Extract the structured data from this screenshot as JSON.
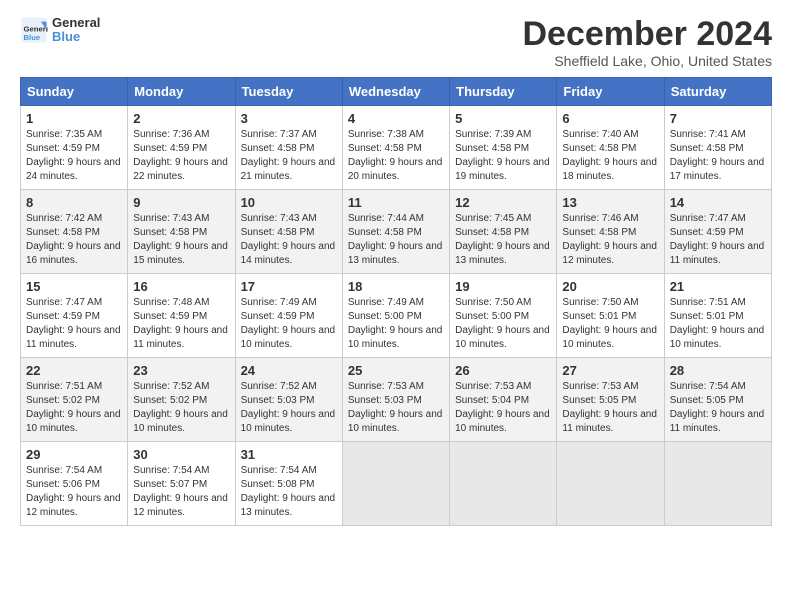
{
  "logo": {
    "line1": "General",
    "line2": "Blue"
  },
  "title": "December 2024",
  "location": "Sheffield Lake, Ohio, United States",
  "days": [
    "Sunday",
    "Monday",
    "Tuesday",
    "Wednesday",
    "Thursday",
    "Friday",
    "Saturday"
  ],
  "weeks": [
    [
      {
        "num": "1",
        "sunrise": "7:35 AM",
        "sunset": "4:59 PM",
        "daylight": "9 hours and 24 minutes."
      },
      {
        "num": "2",
        "sunrise": "7:36 AM",
        "sunset": "4:59 PM",
        "daylight": "9 hours and 22 minutes."
      },
      {
        "num": "3",
        "sunrise": "7:37 AM",
        "sunset": "4:58 PM",
        "daylight": "9 hours and 21 minutes."
      },
      {
        "num": "4",
        "sunrise": "7:38 AM",
        "sunset": "4:58 PM",
        "daylight": "9 hours and 20 minutes."
      },
      {
        "num": "5",
        "sunrise": "7:39 AM",
        "sunset": "4:58 PM",
        "daylight": "9 hours and 19 minutes."
      },
      {
        "num": "6",
        "sunrise": "7:40 AM",
        "sunset": "4:58 PM",
        "daylight": "9 hours and 18 minutes."
      },
      {
        "num": "7",
        "sunrise": "7:41 AM",
        "sunset": "4:58 PM",
        "daylight": "9 hours and 17 minutes."
      }
    ],
    [
      {
        "num": "8",
        "sunrise": "7:42 AM",
        "sunset": "4:58 PM",
        "daylight": "9 hours and 16 minutes."
      },
      {
        "num": "9",
        "sunrise": "7:43 AM",
        "sunset": "4:58 PM",
        "daylight": "9 hours and 15 minutes."
      },
      {
        "num": "10",
        "sunrise": "7:43 AM",
        "sunset": "4:58 PM",
        "daylight": "9 hours and 14 minutes."
      },
      {
        "num": "11",
        "sunrise": "7:44 AM",
        "sunset": "4:58 PM",
        "daylight": "9 hours and 13 minutes."
      },
      {
        "num": "12",
        "sunrise": "7:45 AM",
        "sunset": "4:58 PM",
        "daylight": "9 hours and 13 minutes."
      },
      {
        "num": "13",
        "sunrise": "7:46 AM",
        "sunset": "4:58 PM",
        "daylight": "9 hours and 12 minutes."
      },
      {
        "num": "14",
        "sunrise": "7:47 AM",
        "sunset": "4:59 PM",
        "daylight": "9 hours and 11 minutes."
      }
    ],
    [
      {
        "num": "15",
        "sunrise": "7:47 AM",
        "sunset": "4:59 PM",
        "daylight": "9 hours and 11 minutes."
      },
      {
        "num": "16",
        "sunrise": "7:48 AM",
        "sunset": "4:59 PM",
        "daylight": "9 hours and 11 minutes."
      },
      {
        "num": "17",
        "sunrise": "7:49 AM",
        "sunset": "4:59 PM",
        "daylight": "9 hours and 10 minutes."
      },
      {
        "num": "18",
        "sunrise": "7:49 AM",
        "sunset": "5:00 PM",
        "daylight": "9 hours and 10 minutes."
      },
      {
        "num": "19",
        "sunrise": "7:50 AM",
        "sunset": "5:00 PM",
        "daylight": "9 hours and 10 minutes."
      },
      {
        "num": "20",
        "sunrise": "7:50 AM",
        "sunset": "5:01 PM",
        "daylight": "9 hours and 10 minutes."
      },
      {
        "num": "21",
        "sunrise": "7:51 AM",
        "sunset": "5:01 PM",
        "daylight": "9 hours and 10 minutes."
      }
    ],
    [
      {
        "num": "22",
        "sunrise": "7:51 AM",
        "sunset": "5:02 PM",
        "daylight": "9 hours and 10 minutes."
      },
      {
        "num": "23",
        "sunrise": "7:52 AM",
        "sunset": "5:02 PM",
        "daylight": "9 hours and 10 minutes."
      },
      {
        "num": "24",
        "sunrise": "7:52 AM",
        "sunset": "5:03 PM",
        "daylight": "9 hours and 10 minutes."
      },
      {
        "num": "25",
        "sunrise": "7:53 AM",
        "sunset": "5:03 PM",
        "daylight": "9 hours and 10 minutes."
      },
      {
        "num": "26",
        "sunrise": "7:53 AM",
        "sunset": "5:04 PM",
        "daylight": "9 hours and 10 minutes."
      },
      {
        "num": "27",
        "sunrise": "7:53 AM",
        "sunset": "5:05 PM",
        "daylight": "9 hours and 11 minutes."
      },
      {
        "num": "28",
        "sunrise": "7:54 AM",
        "sunset": "5:05 PM",
        "daylight": "9 hours and 11 minutes."
      }
    ],
    [
      {
        "num": "29",
        "sunrise": "7:54 AM",
        "sunset": "5:06 PM",
        "daylight": "9 hours and 12 minutes."
      },
      {
        "num": "30",
        "sunrise": "7:54 AM",
        "sunset": "5:07 PM",
        "daylight": "9 hours and 12 minutes."
      },
      {
        "num": "31",
        "sunrise": "7:54 AM",
        "sunset": "5:08 PM",
        "daylight": "9 hours and 13 minutes."
      },
      null,
      null,
      null,
      null
    ]
  ]
}
